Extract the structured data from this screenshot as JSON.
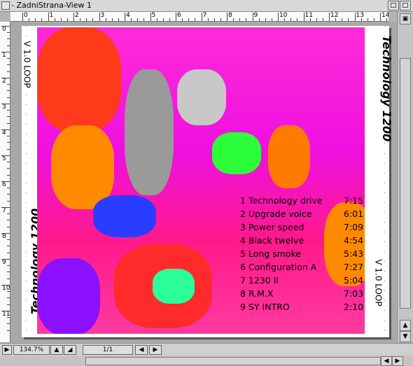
{
  "window": {
    "title": "- ZadniStrana-View 1"
  },
  "ruler": {
    "h_labels": [
      "0",
      "1",
      "2",
      "3",
      "4",
      "5",
      "6",
      "7",
      "8",
      "9",
      "10",
      "11",
      "12",
      "13",
      "14"
    ],
    "v_labels": [
      "0",
      "1",
      "2",
      "3",
      "4",
      "5",
      "6",
      "7",
      "8",
      "9",
      "10",
      "11"
    ]
  },
  "cover": {
    "left_top_text": "V 1.0 LOOP",
    "left_bottom_text": "Technology 1200",
    "right_top_text": "Technology 1200",
    "right_bottom_text": "V 1.0 LOOP",
    "tracks": [
      {
        "title": "1 Technology drive",
        "time": "7:15"
      },
      {
        "title": "2 Upgrade voice",
        "time": "6:01"
      },
      {
        "title": "3 Power speed",
        "time": "7:09"
      },
      {
        "title": "4 Black twelve",
        "time": "4:54"
      },
      {
        "title": "5 Long smoke",
        "time": "5:43"
      },
      {
        "title": "6 Configuration A",
        "time": "7:27"
      },
      {
        "title": "7 1230 II",
        "time": "5:04"
      },
      {
        "title": "8 R.M.X",
        "time": "7:03"
      },
      {
        "title": "9 SY INTRO",
        "time": "2:10"
      }
    ]
  },
  "statusbar": {
    "zoom": "134.7%",
    "page": "1/1"
  },
  "colors": {
    "photo_magenta": "#ff2bd8",
    "photo_orange": "#ff7a00",
    "photo_green": "#2cff3a",
    "photo_blue": "#1a40ff"
  }
}
